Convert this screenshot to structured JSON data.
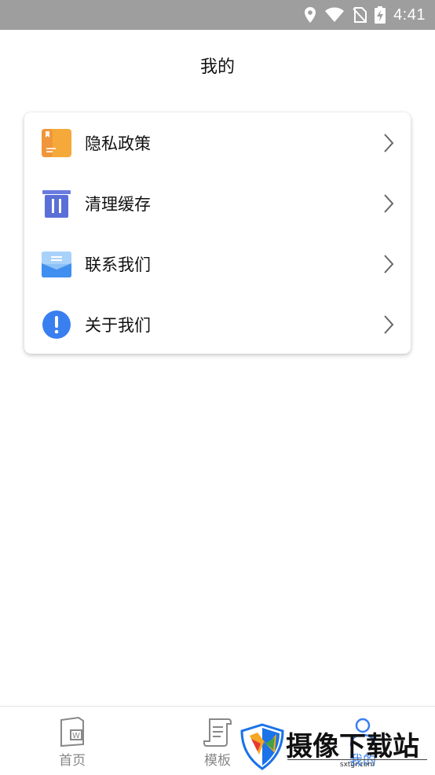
{
  "status_bar": {
    "time": "4:41",
    "icons": [
      "location-icon",
      "wifi-icon",
      "no-sim-icon",
      "battery-charging-icon"
    ]
  },
  "header": {
    "title": "我的"
  },
  "menu": {
    "items": [
      {
        "label": "隐私政策",
        "icon": "document-icon"
      },
      {
        "label": "清理缓存",
        "icon": "trash-icon"
      },
      {
        "label": "联系我们",
        "icon": "mail-icon"
      },
      {
        "label": "关于我们",
        "icon": "info-icon"
      }
    ],
    "chevron": "chevron-right-icon"
  },
  "bottom_nav": {
    "tabs": [
      {
        "label": "首页",
        "icon": "word-document-icon"
      },
      {
        "label": "模板",
        "icon": "template-scroll-icon"
      },
      {
        "label": "我的",
        "icon": "user-icon"
      }
    ]
  },
  "watermark": {
    "text": "摄像下载站",
    "url": "sxtgr.com"
  },
  "colors": {
    "status_bar": "#9e9e9e",
    "doc_icon": "#f6a93b",
    "trash_icon": "#5a6fd8",
    "mail_icon": "#4a9ef0",
    "info_icon": "#3a7ff0"
  }
}
